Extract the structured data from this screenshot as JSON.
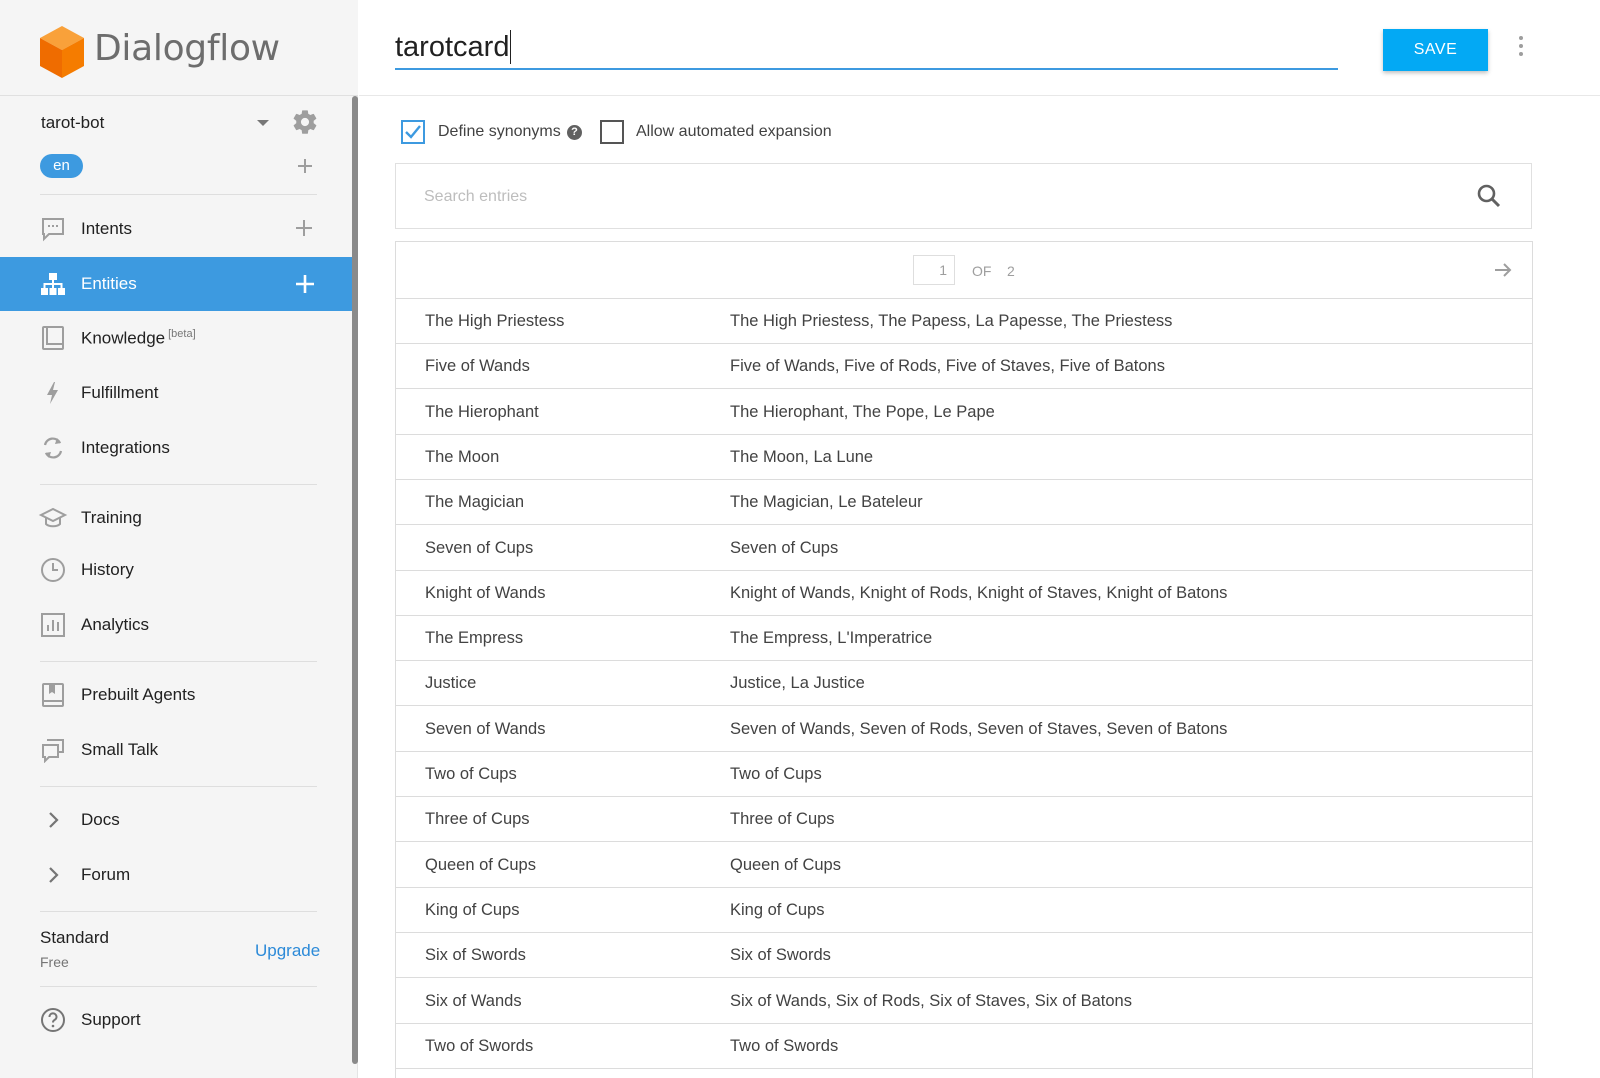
{
  "app": {
    "brand": "Dialogflow"
  },
  "agent": {
    "name": "tarot-bot",
    "language": "en"
  },
  "nav": {
    "intents": "Intents",
    "entities": "Entities",
    "knowledge": "Knowledge",
    "knowledge_badge": "[beta]",
    "fulfillment": "Fulfillment",
    "integrations": "Integrations",
    "training": "Training",
    "history": "History",
    "analytics": "Analytics",
    "prebuilt_agents": "Prebuilt Agents",
    "small_talk": "Small Talk",
    "docs": "Docs",
    "forum": "Forum",
    "support": "Support"
  },
  "plan": {
    "name": "Standard",
    "tier": "Free",
    "upgrade_label": "Upgrade"
  },
  "entity": {
    "name": "tarotcard",
    "save_label": "SAVE"
  },
  "options": {
    "define_synonyms": {
      "label": "Define synonyms",
      "checked": true
    },
    "automated_expansion": {
      "label": "Allow automated expansion",
      "checked": false
    }
  },
  "search": {
    "placeholder": "Search entries"
  },
  "pagination": {
    "current": "1",
    "of_label": "OF",
    "total": "2"
  },
  "entries": [
    {
      "value": "The High Priestess",
      "synonyms": "The High Priestess, The Papess, La Papesse, The Priestess"
    },
    {
      "value": "Five of Wands",
      "synonyms": "Five of Wands, Five of Rods, Five of Staves, Five of Batons"
    },
    {
      "value": "The Hierophant",
      "synonyms": "The Hierophant, The Pope, Le Pape"
    },
    {
      "value": "The Moon",
      "synonyms": "The Moon, La Lune"
    },
    {
      "value": "The Magician",
      "synonyms": "The Magician, Le Bateleur"
    },
    {
      "value": "Seven of Cups",
      "synonyms": "Seven of Cups"
    },
    {
      "value": "Knight of Wands",
      "synonyms": "Knight of Wands, Knight of Rods, Knight of Staves, Knight of Batons"
    },
    {
      "value": "The Empress",
      "synonyms": "The Empress, L'Imperatrice"
    },
    {
      "value": "Justice",
      "synonyms": "Justice, La Justice"
    },
    {
      "value": "Seven of Wands",
      "synonyms": "Seven of Wands, Seven of Rods, Seven of Staves, Seven of Batons"
    },
    {
      "value": "Two of Cups",
      "synonyms": "Two of Cups"
    },
    {
      "value": "Three of Cups",
      "synonyms": "Three of Cups"
    },
    {
      "value": "Queen of Cups",
      "synonyms": "Queen of Cups"
    },
    {
      "value": "King of Cups",
      "synonyms": "King of Cups"
    },
    {
      "value": "Six of Swords",
      "synonyms": "Six of Swords"
    },
    {
      "value": "Six of Wands",
      "synonyms": "Six of Wands, Six of Rods, Six of Staves, Six of Batons"
    },
    {
      "value": "Two of Swords",
      "synonyms": "Two of Swords"
    }
  ],
  "colors": {
    "accent": "#3d9ae0",
    "save_button": "#03a9f4",
    "logo_orange": "#f5821f"
  },
  "icons": [
    "dialogflow-logo-icon",
    "chevron-down-icon",
    "gear-icon",
    "plus-icon",
    "chat-icon",
    "entities-icon",
    "book-icon",
    "bolt-icon",
    "sync-icon",
    "graduation-cap-icon",
    "clock-icon",
    "bar-chart-icon",
    "bookmark-icon",
    "chat-bubbles-icon",
    "chevron-right-icon",
    "help-circle-icon",
    "search-icon",
    "arrow-right-icon",
    "more-vert-icon",
    "checkmark-icon"
  ]
}
